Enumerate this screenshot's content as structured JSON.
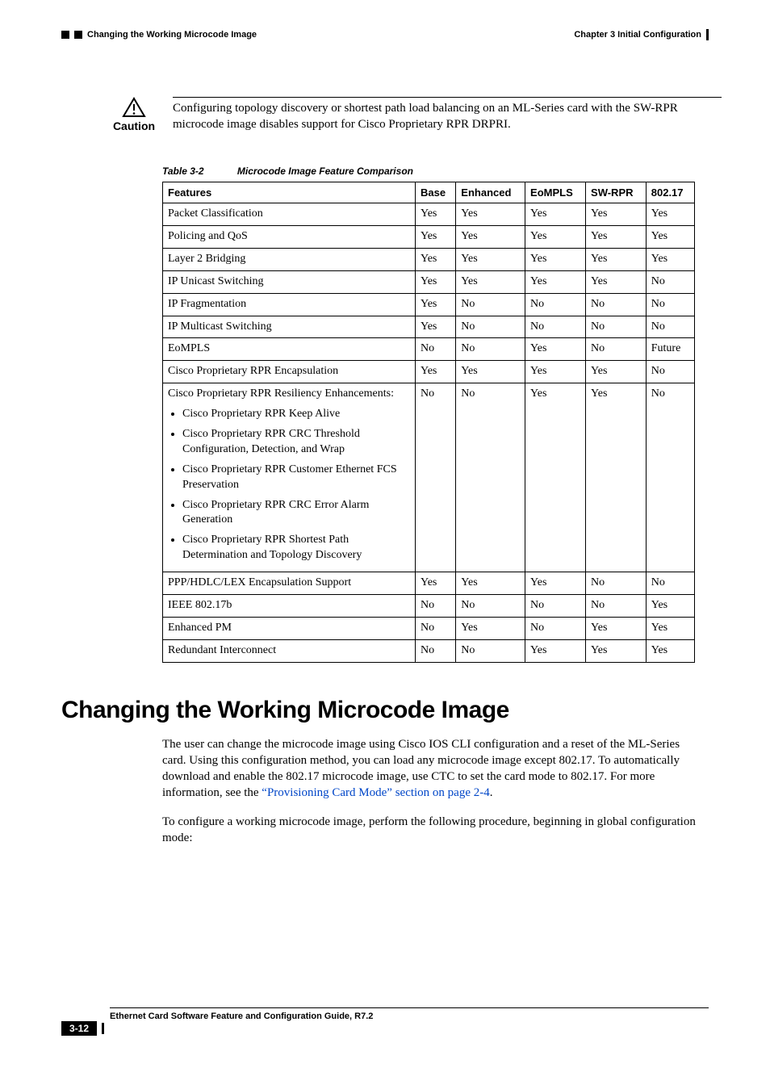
{
  "header": {
    "left": "Changing the Working Microcode Image",
    "right": "Chapter 3 Initial Configuration"
  },
  "caution": {
    "label": "Caution",
    "text": "Configuring topology discovery or shortest path load balancing on an ML-Series card with the SW-RPR microcode image disables support for Cisco Proprietary RPR DRPRI."
  },
  "table": {
    "caption_num": "Table 3-2",
    "caption_title": "Microcode Image Feature Comparison",
    "headers": [
      "Features",
      "Base",
      "Enhanced",
      "EoMPLS",
      "SW-RPR",
      "802.17"
    ],
    "rows": [
      {
        "feature": "Packet Classification",
        "cells": [
          "Yes",
          "Yes",
          "Yes",
          "Yes",
          "Yes"
        ]
      },
      {
        "feature": "Policing and QoS",
        "cells": [
          "Yes",
          "Yes",
          "Yes",
          "Yes",
          "Yes"
        ]
      },
      {
        "feature": "Layer 2 Bridging",
        "cells": [
          "Yes",
          "Yes",
          "Yes",
          "Yes",
          "Yes"
        ]
      },
      {
        "feature": "IP Unicast Switching",
        "cells": [
          "Yes",
          "Yes",
          "Yes",
          "Yes",
          "No"
        ]
      },
      {
        "feature": "IP Fragmentation",
        "cells": [
          "Yes",
          "No",
          "No",
          "No",
          "No"
        ]
      },
      {
        "feature": "IP Multicast Switching",
        "cells": [
          "Yes",
          "No",
          "No",
          "No",
          "No"
        ]
      },
      {
        "feature": "EoMPLS",
        "cells": [
          "No",
          "No",
          "Yes",
          "No",
          "Future"
        ]
      },
      {
        "feature": "Cisco Proprietary RPR Encapsulation",
        "cells": [
          "Yes",
          "Yes",
          "Yes",
          "Yes",
          "No"
        ]
      },
      {
        "feature": "Cisco Proprietary RPR Resiliency Enhancements:",
        "cells": [
          "No",
          "No",
          "Yes",
          "Yes",
          "No"
        ],
        "bullets": [
          "Cisco Proprietary RPR Keep Alive",
          "Cisco Proprietary RPR CRC Threshold Configuration, Detection, and Wrap",
          "Cisco Proprietary RPR Customer Ethernet FCS Preservation",
          "Cisco Proprietary RPR CRC Error Alarm Generation",
          "Cisco Proprietary RPR Shortest Path Determination and Topology Discovery"
        ]
      },
      {
        "feature": "PPP/HDLC/LEX Encapsulation Support",
        "cells": [
          "Yes",
          "Yes",
          "Yes",
          "No",
          "No"
        ]
      },
      {
        "feature": "IEEE 802.17b",
        "cells": [
          "No",
          "No",
          "No",
          "No",
          "Yes"
        ]
      },
      {
        "feature": "Enhanced PM",
        "cells": [
          "No",
          "Yes",
          "No",
          "Yes",
          "Yes"
        ]
      },
      {
        "feature": "Redundant Interconnect",
        "cells": [
          "No",
          "No",
          "Yes",
          "Yes",
          "Yes"
        ]
      }
    ]
  },
  "section": {
    "heading": "Changing the Working Microcode Image",
    "para1_a": "The user can change the microcode image using Cisco IOS CLI configuration and a reset of the ML-Series card. Using this configuration method, you can load any microcode image except 802.17. To automatically download and enable the 802.17 microcode image, use CTC to set the card mode to 802.17. For more information, see the ",
    "para1_link": "“Provisioning Card Mode” section on page 2-4",
    "para1_b": ".",
    "para2": "To configure a working microcode image, perform the following procedure, beginning in global configuration mode:"
  },
  "footer": {
    "title": "Ethernet Card Software Feature and Configuration Guide, R7.2",
    "page": "3-12"
  }
}
